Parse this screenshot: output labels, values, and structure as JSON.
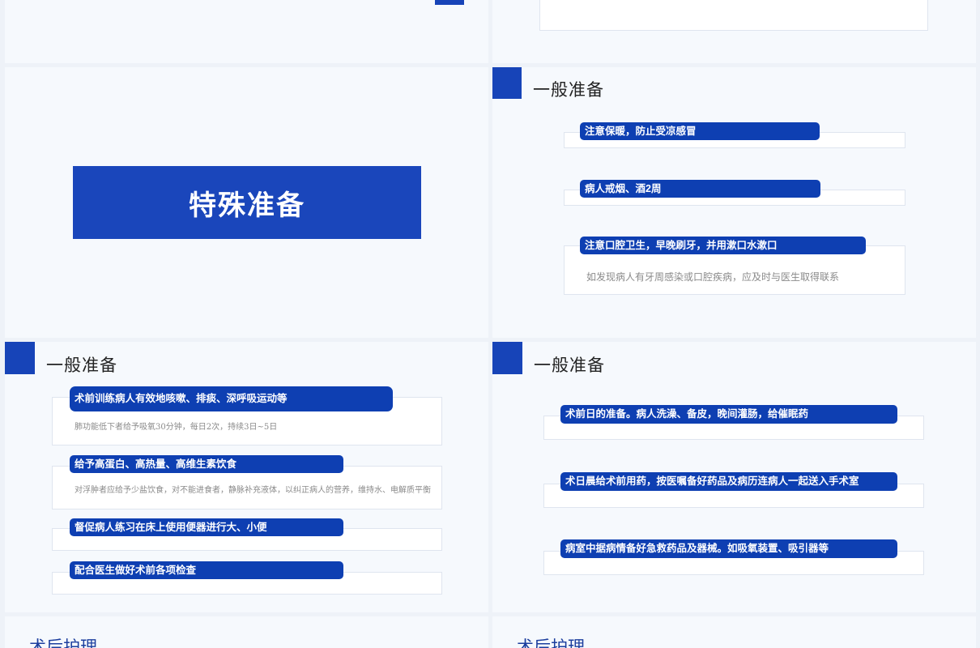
{
  "colors": {
    "accent": "#1744b8",
    "pill": "#0e3fb2",
    "background": "#f6f9fd"
  },
  "slide_special": {
    "title": "特殊准备"
  },
  "slide_general_a": {
    "title": "一般准备",
    "items": [
      {
        "label": "注意保暖，防止受凉感冒",
        "desc": ""
      },
      {
        "label": "病人戒烟、酒2周",
        "desc": ""
      },
      {
        "label": "注意口腔卫生，早晚刷牙，并用漱口水漱口",
        "desc": "如发现病人有牙周感染或口腔疾病，应及时与医生取得联系"
      }
    ]
  },
  "slide_general_b": {
    "title": "一般准备",
    "items": [
      {
        "label": "术前训练病人有效地咳嗽、排痰、深呼吸运动等",
        "desc": "肺功能低下者给予吸氧30分钟，每日2次，持续3日~5日"
      },
      {
        "label": "给予高蛋白、高热量、高维生素饮食",
        "desc": "对浮肿者应给予少盐饮食，对不能进食者，静脉补充液体，以纠正病人的营养，维持水、电解质平衡"
      },
      {
        "label": "督促病人练习在床上使用便器进行大、小便",
        "desc": ""
      },
      {
        "label": "配合医生做好术前各项检查",
        "desc": ""
      }
    ]
  },
  "slide_general_c": {
    "title": "一般准备",
    "items": [
      {
        "label": "术前日的准备。病人洗澡、备皮，晚间灌肠，给催眠药"
      },
      {
        "label": "术日晨给术前用药，按医嘱备好药品及病历连病人一起送入手术室"
      },
      {
        "label": "病室中据病情备好急救药品及器械。如吸氧装置、吸引器等"
      }
    ]
  },
  "slide_post_left": {
    "title": "术后护理"
  },
  "slide_post_right": {
    "title": "术后护理"
  }
}
